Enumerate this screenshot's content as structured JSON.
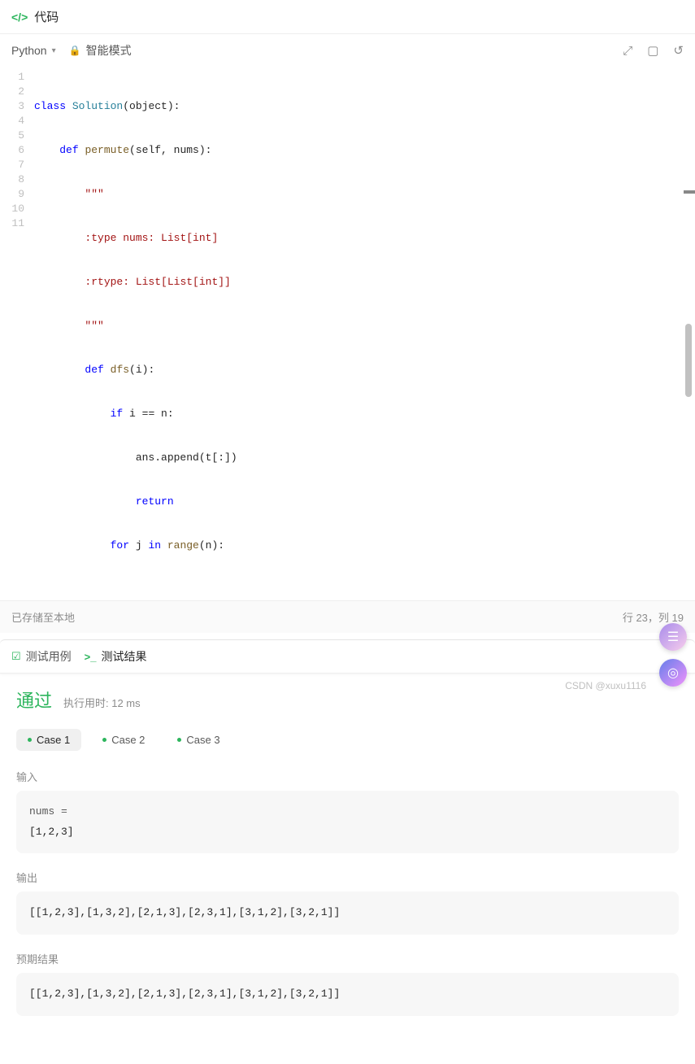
{
  "header": {
    "title": "代码"
  },
  "toolbar": {
    "language": "Python",
    "mode_label": "智能模式"
  },
  "editor": {
    "lines": [
      "1",
      "2",
      "3",
      "4",
      "5",
      "6",
      "7",
      "8",
      "9",
      "10",
      "11"
    ]
  },
  "code": {
    "l1": {
      "kw1": "class",
      "cls": "Solution",
      "rest": "(object):"
    },
    "l2": {
      "kw1": "def",
      "fn": "permute",
      "rest": "(self, nums):"
    },
    "l3": "\"\"\"",
    "l4": ":type nums: List[int]",
    "l5": ":rtype: List[List[int]]",
    "l6": "\"\"\"",
    "l7": {
      "kw1": "def",
      "fn": "dfs",
      "rest": "(i):"
    },
    "l8": {
      "kw1": "if",
      "rest": " i == n:"
    },
    "l9": "ans.append(t[:])",
    "l10": {
      "kw1": "return"
    },
    "l11": {
      "kw1": "for",
      "mid": " j ",
      "kw2": "in",
      "fn": " range",
      "rest": "(n):"
    }
  },
  "status": {
    "saved": "已存储至本地",
    "cursor": "行 23，列 19"
  },
  "tabs": {
    "testcases": "测试用例",
    "results": "测试结果"
  },
  "result": {
    "pass": "通过",
    "time": "执行用时: 12 ms",
    "cases": [
      "Case 1",
      "Case 2",
      "Case 3"
    ],
    "input_label": "输入",
    "input_var": "nums =",
    "input_val": "[1,2,3]",
    "output_label": "输出",
    "output_val": "[[1,2,3],[1,3,2],[2,1,3],[2,3,1],[3,1,2],[3,2,1]]",
    "expected_label": "预期结果",
    "expected_val": "[[1,2,3],[1,3,2],[2,1,3],[2,3,1],[3,1,2],[3,2,1]]"
  },
  "watermark": "CSDN @xuxu1116"
}
